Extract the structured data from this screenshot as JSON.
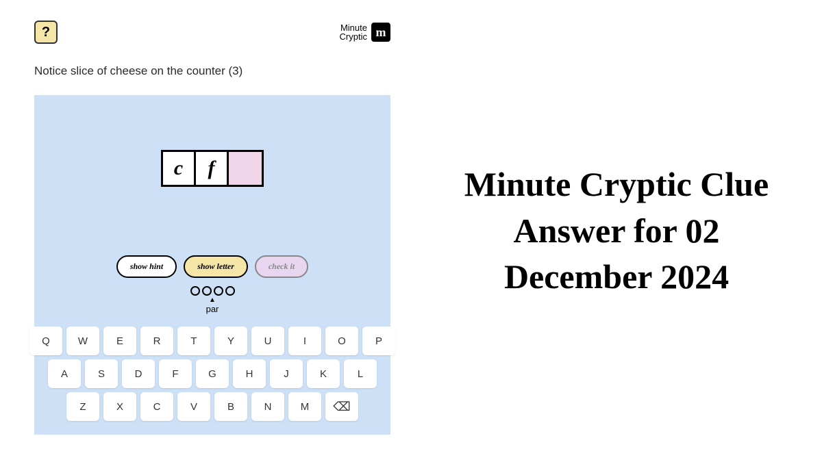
{
  "header": {
    "help_label": "?",
    "logo_text_line1": "Minute",
    "logo_text_line2": "Cryptic",
    "logo_icon": "m"
  },
  "clue": "Notice slice of cheese on the counter (3)",
  "answer": {
    "cells": [
      "c",
      "f",
      ""
    ]
  },
  "controls": {
    "hint": "show hint",
    "letter": "show letter",
    "check": "check it"
  },
  "par": {
    "count": 4,
    "label": "par"
  },
  "keyboard": {
    "row1": [
      "Q",
      "W",
      "E",
      "R",
      "T",
      "Y",
      "U",
      "I",
      "O",
      "P"
    ],
    "row2": [
      "A",
      "S",
      "D",
      "F",
      "G",
      "H",
      "J",
      "K",
      "L"
    ],
    "row3": [
      "Z",
      "X",
      "C",
      "V",
      "B",
      "N",
      "M",
      "⌫"
    ]
  },
  "title": "Minute Cryptic Clue Answer for 02 December 2024"
}
